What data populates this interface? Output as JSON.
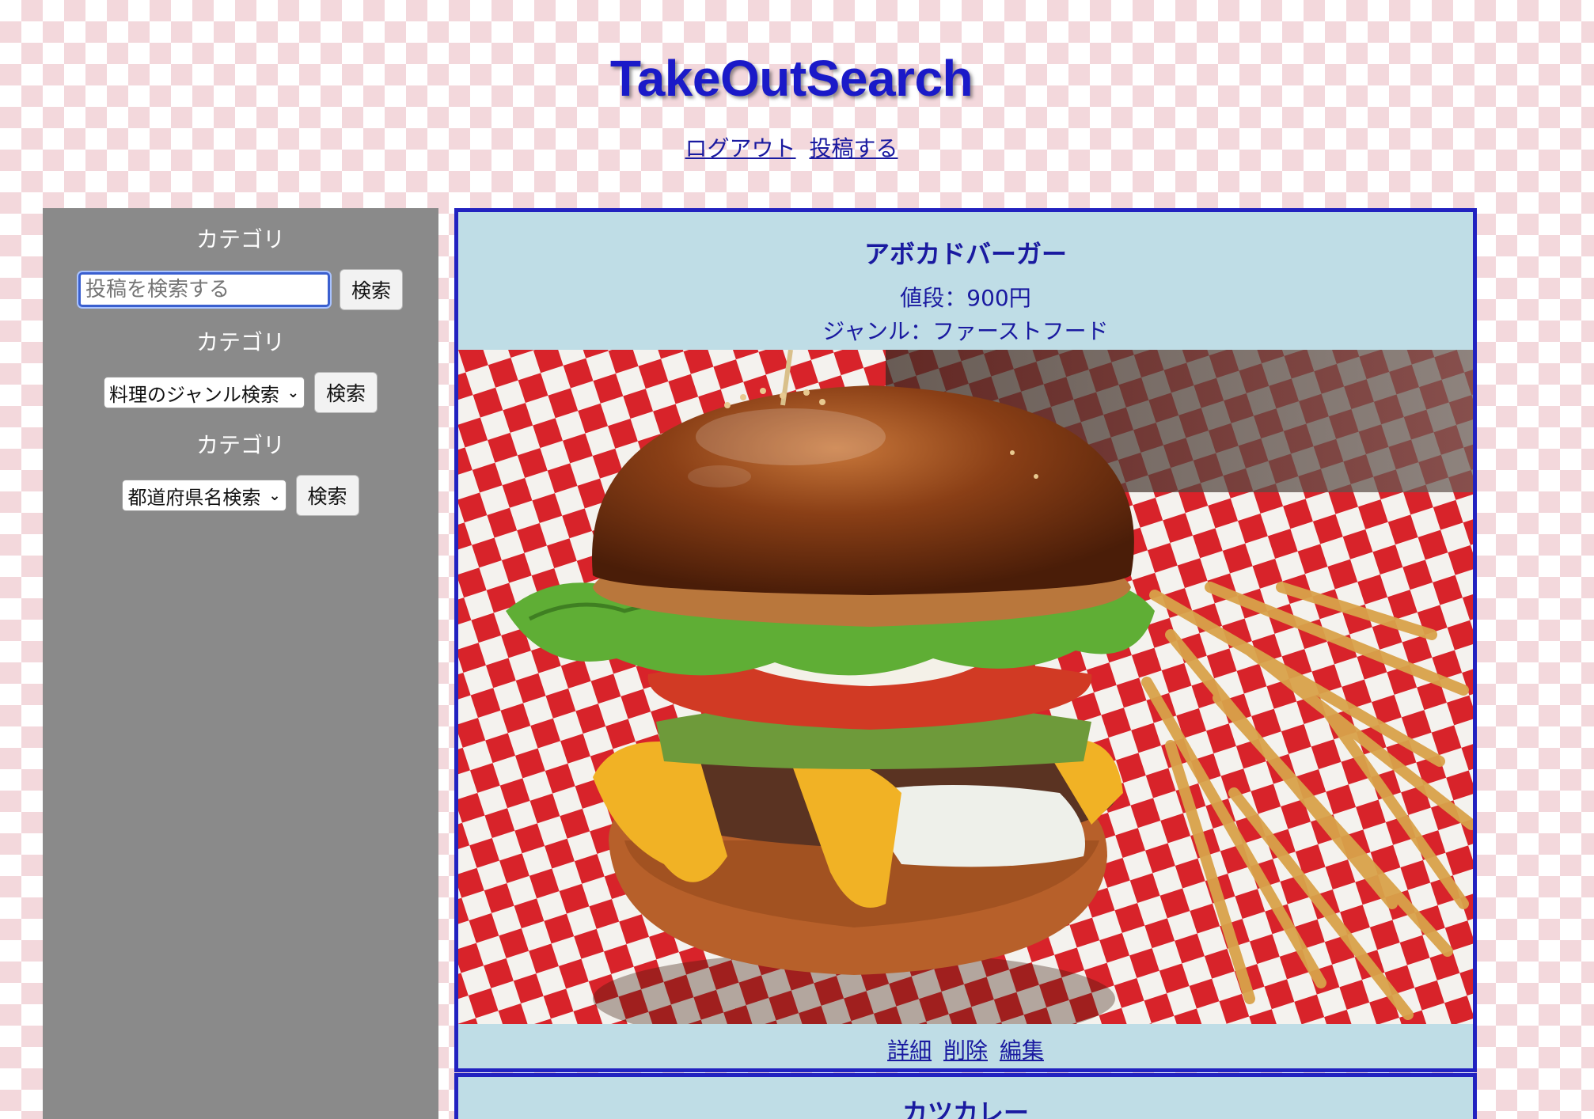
{
  "header": {
    "site_title": "TakeOutSearch",
    "nav": {
      "logout": "ログアウト",
      "post": "投稿する"
    }
  },
  "sidebar": {
    "keyword": {
      "label": "カテゴリ",
      "placeholder": "投稿を検索する",
      "button": "検索"
    },
    "genre": {
      "label": "カテゴリ",
      "selected": "料理のジャンル検索",
      "button": "検索"
    },
    "prefecture": {
      "label": "カテゴリ",
      "selected": "都道府県名検索",
      "button": "検索"
    }
  },
  "posts": [
    {
      "title": "アボカドバーガー",
      "price": "値段：900円",
      "genre": "ジャンル：ファーストフード",
      "image": "burger-and-fries-photo",
      "actions": {
        "detail": "詳細",
        "delete": "削除",
        "edit": "編集"
      }
    },
    {
      "title": "カツカレー"
    }
  ],
  "colors": {
    "accent": "#1a1ac8",
    "sidebar_bg": "#8a8a8a",
    "card_bg": "#bfdde6",
    "card_border": "#2222c0",
    "page_checker": "#f3d8dc"
  }
}
